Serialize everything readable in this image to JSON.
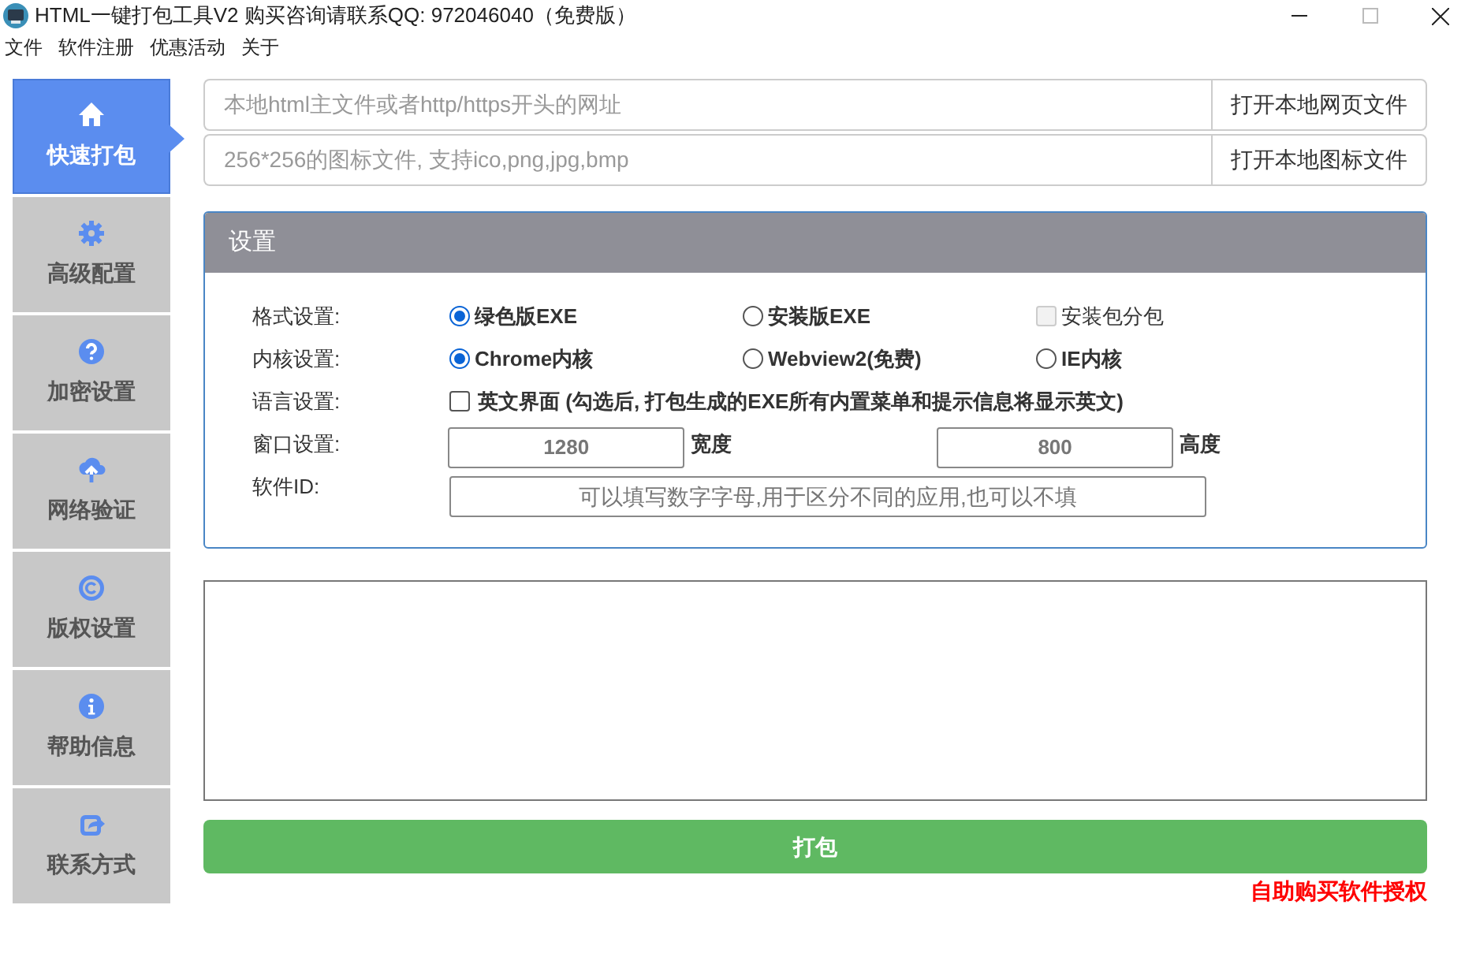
{
  "window": {
    "title": "HTML一键打包工具V2 购买咨询请联系QQ: 972046040（免费版）"
  },
  "menu": [
    "文件",
    "软件注册",
    "优惠活动",
    "关于"
  ],
  "sidebar": {
    "items": [
      {
        "label": "快速打包",
        "selected": true
      },
      {
        "label": "高级配置",
        "selected": false
      },
      {
        "label": "加密设置",
        "selected": false
      },
      {
        "label": "网络验证",
        "selected": false
      },
      {
        "label": "版权设置",
        "selected": false
      },
      {
        "label": "帮助信息",
        "selected": false
      },
      {
        "label": "联系方式",
        "selected": false
      }
    ]
  },
  "file_inputs": [
    {
      "placeholder": "本地html主文件或者http/https开头的网址",
      "button": "打开本地网页文件"
    },
    {
      "placeholder": "256*256的图标文件, 支持ico,png,jpg,bmp",
      "button": "打开本地图标文件"
    }
  ],
  "settings": {
    "title": "设置",
    "rows": [
      {
        "label": "格式设置:",
        "kind": "options",
        "options": [
          {
            "label": "绿色版EXE",
            "kind": "radio",
            "selected": true
          },
          {
            "label": "安装版EXE",
            "kind": "radio",
            "selected": false
          },
          {
            "label": "安装包分包",
            "kind": "checkbox",
            "checked": false,
            "disabled": true
          }
        ]
      },
      {
        "label": "内核设置:",
        "kind": "options",
        "options": [
          {
            "label": "Chrome内核",
            "kind": "radio",
            "selected": true
          },
          {
            "label": "Webview2(免费)",
            "kind": "radio",
            "selected": false
          },
          {
            "label": "IE内核",
            "kind": "radio",
            "selected": false
          }
        ]
      },
      {
        "label": "语言设置:",
        "kind": "checkbox",
        "text": "英文界面 (勾选后, 打包生成的EXE所有内置菜单和提示信息将显示英文)",
        "checked": false
      },
      {
        "label": "窗口设置:",
        "kind": "size",
        "width": {
          "placeholder": "1280",
          "unit": "宽度"
        },
        "height": {
          "placeholder": "800",
          "unit": "高度"
        }
      },
      {
        "label": "软件ID:",
        "kind": "text",
        "placeholder": "可以填写数字字母,用于区分不同的应用,也可以不填"
      }
    ]
  },
  "pack_button": "打包",
  "purchase_link": "自助购买软件授权"
}
